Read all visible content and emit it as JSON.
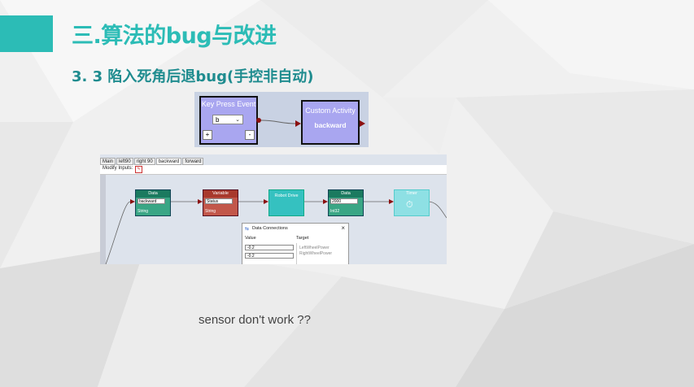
{
  "slide": {
    "title": "三.算法的bug与改进",
    "subtitle": "3. 3  陷入死角后退bug(手控非自动)",
    "caption": "sensor don't work ??",
    "accent_color": "#2cbcb6"
  },
  "screenshot_top": {
    "key_press_block": {
      "title": "Key Press Event",
      "selected_key": "b",
      "plus_label": "+",
      "minus_label": "-"
    },
    "custom_activity_block": {
      "title": "Custom Activity",
      "name": "backward"
    }
  },
  "screenshot_bottom": {
    "tabs": [
      "Main",
      "left90",
      "right 90",
      "backward",
      "forward"
    ],
    "active_tab": "backward",
    "modify_inputs_label": "Modify Inputs:",
    "nodes": [
      {
        "title": "Data",
        "field": "backward",
        "type": "String",
        "color": "#1b7a5f"
      },
      {
        "title": "Variable",
        "field": "Status",
        "type": "String",
        "color": "#a8392c"
      },
      {
        "title": "Robot Drive",
        "field": "",
        "type": "",
        "color": "#35c1c0"
      },
      {
        "title": "Data",
        "field": "2000",
        "type": "Int32",
        "color": "#1b7a5f"
      },
      {
        "title": "Timer",
        "field": "",
        "type": "",
        "color": "#8ee0e4"
      }
    ],
    "dialog": {
      "title": "Data Connections",
      "close": "×",
      "value_header": "Value",
      "target_header": "Target",
      "values": [
        "-0.2",
        "-0.2"
      ],
      "targets": [
        "LeftWheelPower",
        "RightWheelPower"
      ]
    }
  }
}
